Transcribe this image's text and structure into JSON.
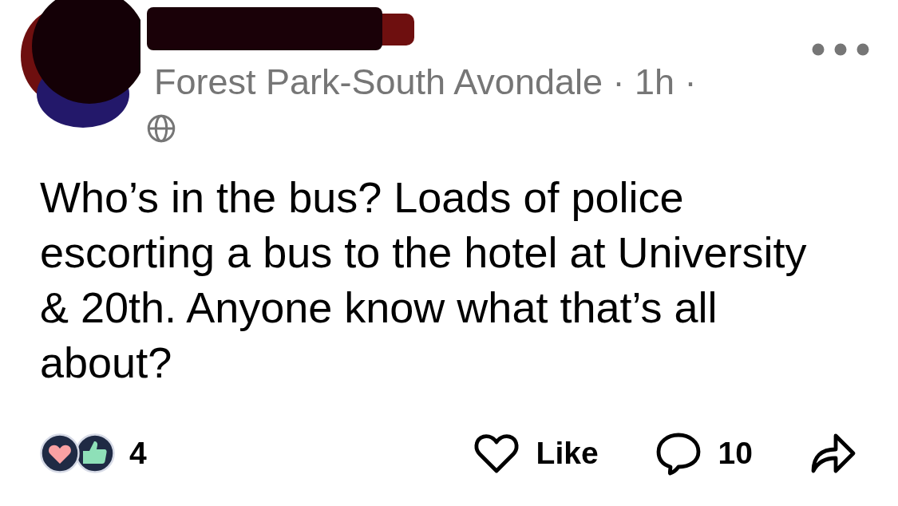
{
  "post": {
    "meta": "Forest Park-South Avondale · 1h ·",
    "body": "Who’s in the bus? Loads of police escorting a bus to the hotel at University & 20th. Anyone know what that’s all about?",
    "reactions": {
      "count": "4"
    },
    "actions": [
      {
        "kind": "like",
        "label": "Like"
      },
      {
        "kind": "comment",
        "label": "10"
      },
      {
        "kind": "share"
      }
    ]
  }
}
